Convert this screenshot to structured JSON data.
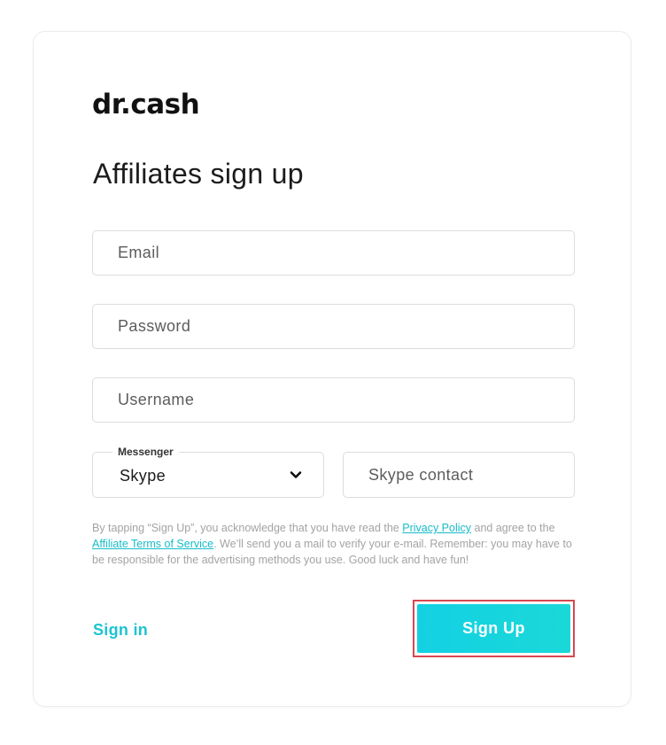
{
  "brand": {
    "logo_text": "dr.cash"
  },
  "form": {
    "title": "Affiliates sign up",
    "email": {
      "placeholder": "Email",
      "value": ""
    },
    "password": {
      "placeholder": "Password",
      "value": ""
    },
    "username": {
      "placeholder": "Username",
      "value": ""
    },
    "messenger": {
      "label": "Messenger",
      "selected": "Skype",
      "icon": "chevron-down-icon"
    },
    "contact": {
      "placeholder": "Skype contact",
      "value": ""
    },
    "legal": {
      "part1": "By tapping “Sign Up”, you acknowledge that you have read the ",
      "privacy_link": "Privacy Policy",
      "part2": " and agree to the ",
      "terms_link": "Affiliate Terms of Service",
      "part3": ". We’ll send you a mail to verify your e-mail. Remember: you may have to be responsible for the advertising methods you use. Good luck and have fun!"
    },
    "sign_in_label": "Sign in",
    "sign_up_label": "Sign Up"
  },
  "colors": {
    "accent": "#1cc4d0",
    "button_gradient_start": "#13d1e3",
    "button_gradient_end": "#1ad8d8",
    "highlight_outline": "#d9474f",
    "legal_text": "#a3a3a3"
  }
}
